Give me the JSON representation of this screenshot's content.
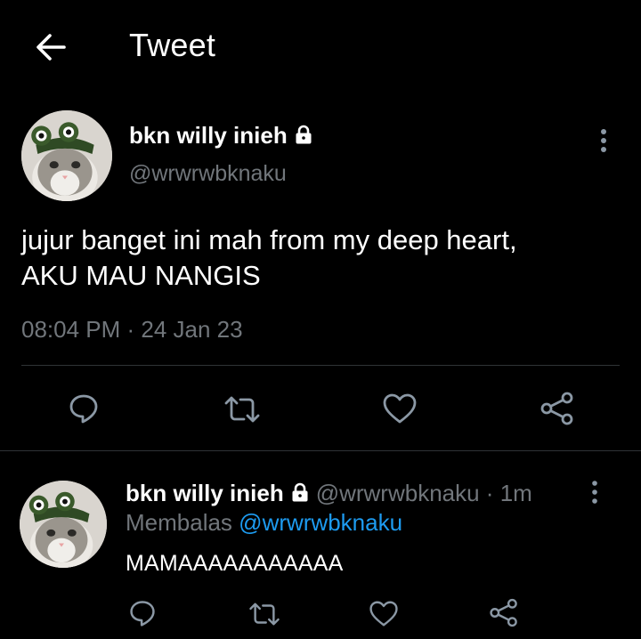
{
  "header": {
    "title": "Tweet",
    "back_icon": "arrow-left-icon"
  },
  "tweet": {
    "author_name": "bkn willy inieh",
    "handle": "@wrwrwbknaku",
    "text_line1": "jujur banget ini mah from my deep heart,",
    "text_line2": "AKU MAU NANGIS",
    "timestamp": "08:04 PM · 24 Jan 23",
    "actions": [
      "reply-icon",
      "retweet-icon",
      "like-icon",
      "share-icon"
    ]
  },
  "reply": {
    "author_name": "bkn willy inieh",
    "meta": "@wrwrwbknaku · 1m",
    "replying_prefix": "Membalas",
    "replying_to": "@wrwrwbknaku",
    "text": "MAMAAAAAAAAAAA",
    "actions": [
      "reply-icon",
      "retweet-icon",
      "like-icon",
      "share-icon"
    ]
  },
  "colors": {
    "background": "#000000",
    "text": "#ffffff",
    "muted": "#71767b",
    "link": "#1d9bf0",
    "divider": "#2f3336"
  }
}
